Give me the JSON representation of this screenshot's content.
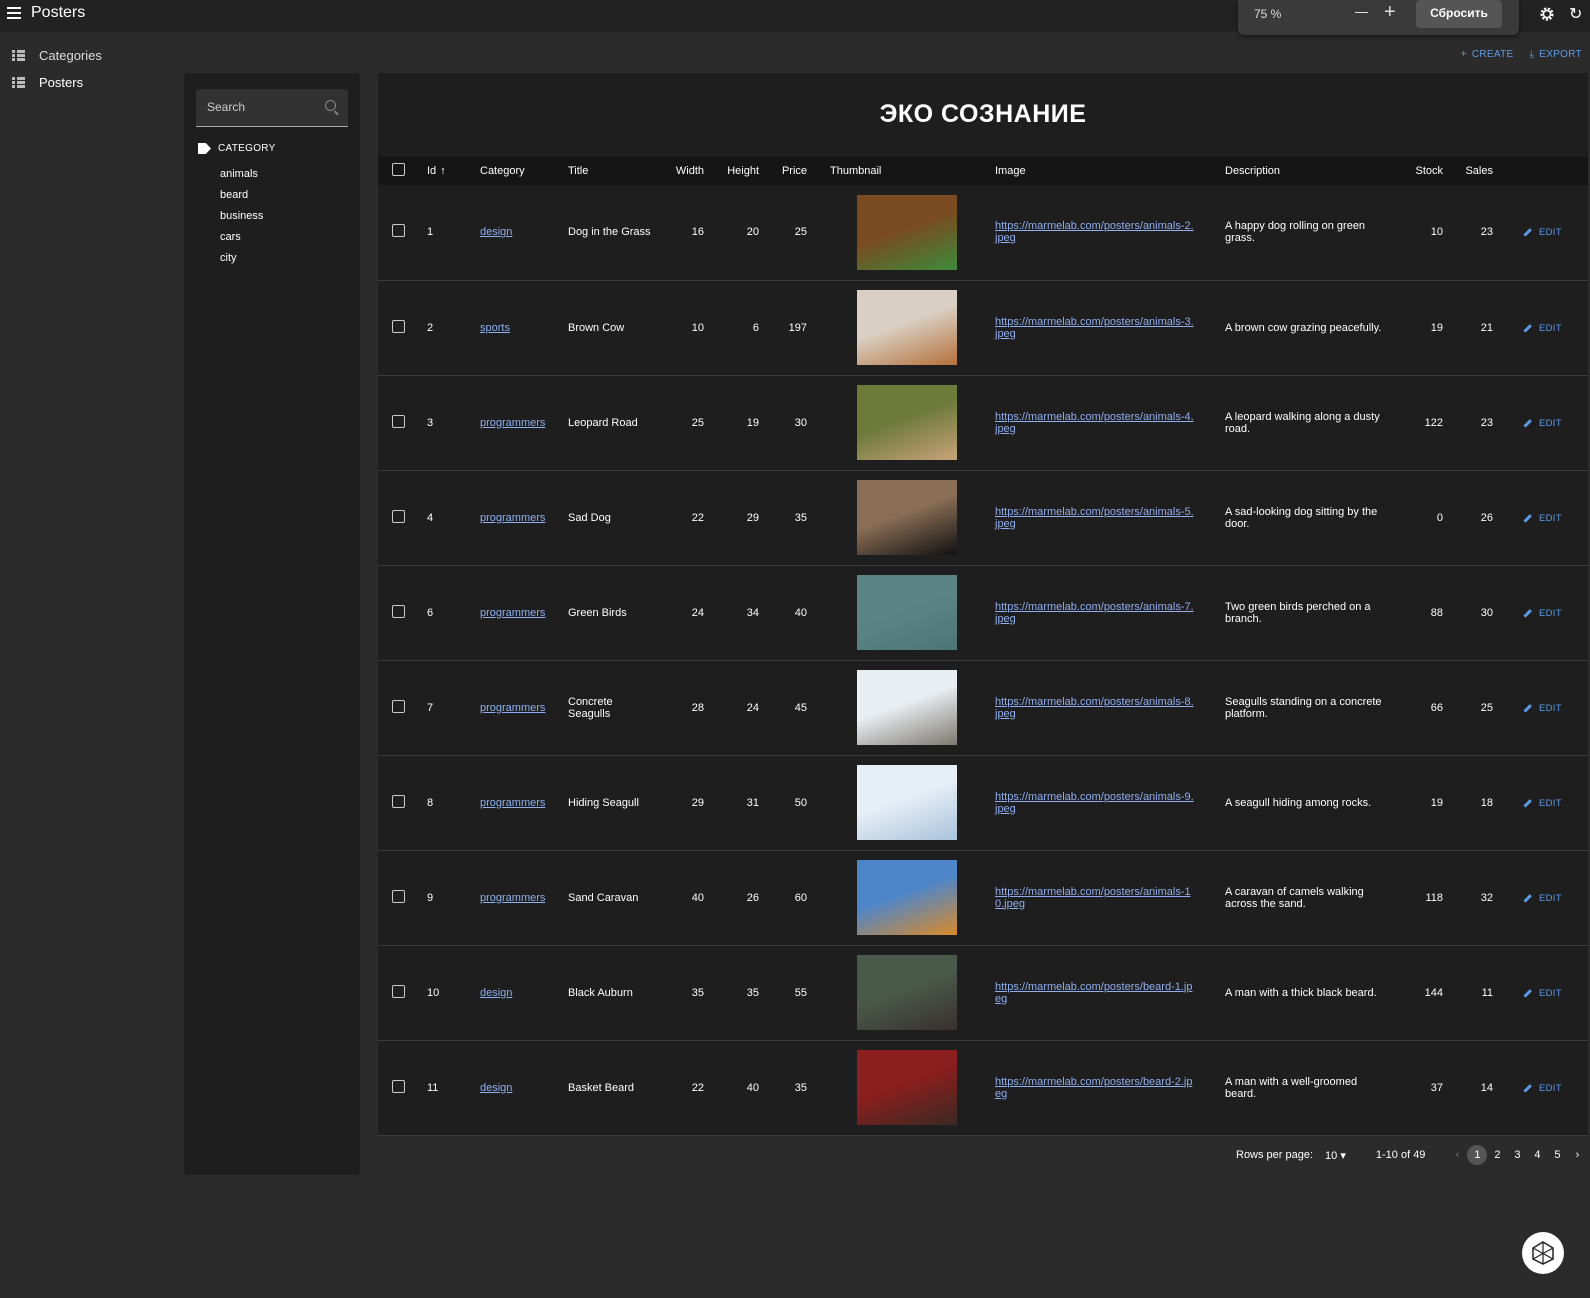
{
  "app": {
    "title": "Posters"
  },
  "zoom": {
    "value": "75 %",
    "reset_label": "Сбросить"
  },
  "sidebar": {
    "items": [
      {
        "label": "Categories"
      },
      {
        "label": "Posters"
      }
    ]
  },
  "actions": {
    "create_label": "CREATE",
    "export_label": "EXPORT"
  },
  "filter": {
    "search_placeholder": "Search",
    "category_heading": "CATEGORY",
    "categories": [
      "animals",
      "beard",
      "business",
      "cars",
      "city"
    ]
  },
  "page": {
    "heading": "ЭКО СОЗНАНИЕ"
  },
  "table": {
    "headers": {
      "id": "Id",
      "category": "Category",
      "title": "Title",
      "width": "Width",
      "height": "Height",
      "price": "Price",
      "thumbnail": "Thumbnail",
      "image": "Image",
      "description": "Description",
      "stock": "Stock",
      "sales": "Sales"
    },
    "edit_label": "EDIT",
    "rows": [
      {
        "id": "1",
        "category": "design",
        "title": "Dog in the Grass",
        "width": "16",
        "height": "20",
        "price": "25",
        "image": "https://marmelab.com/posters/animals-2.jpeg",
        "description": "A happy dog rolling on green grass.",
        "stock": "10",
        "sales": "23",
        "thumb_colors": [
          "#7a4a22",
          "#3e8a3a"
        ]
      },
      {
        "id": "2",
        "category": "sports",
        "title": "Brown Cow",
        "width": "10",
        "height": "6",
        "price": "197",
        "image": "https://marmelab.com/posters/animals-3.jpeg",
        "description": "A brown cow grazing peacefully.",
        "stock": "19",
        "sales": "21",
        "thumb_colors": [
          "#d9cfc2",
          "#b4703a"
        ]
      },
      {
        "id": "3",
        "category": "programmers",
        "title": "Leopard Road",
        "width": "25",
        "height": "19",
        "price": "30",
        "image": "https://marmelab.com/posters/animals-4.jpeg",
        "description": "A leopard walking along a dusty road.",
        "stock": "122",
        "sales": "23",
        "thumb_colors": [
          "#6d7a3a",
          "#c8a27a"
        ]
      },
      {
        "id": "4",
        "category": "programmers",
        "title": "Sad Dog",
        "width": "22",
        "height": "29",
        "price": "35",
        "image": "https://marmelab.com/posters/animals-5.jpeg",
        "description": "A sad-looking dog sitting by the door.",
        "stock": "0",
        "sales": "26",
        "thumb_colors": [
          "#8a6e55",
          "#111111"
        ]
      },
      {
        "id": "6",
        "category": "programmers",
        "title": "Green Birds",
        "width": "24",
        "height": "34",
        "price": "40",
        "image": "https://marmelab.com/posters/animals-7.jpeg",
        "description": "Two green birds perched on a branch.",
        "stock": "88",
        "sales": "30",
        "thumb_colors": [
          "#5b8585",
          "#4d7575"
        ]
      },
      {
        "id": "7",
        "category": "programmers",
        "title": "Concrete Seagulls",
        "width": "28",
        "height": "24",
        "price": "45",
        "image": "https://marmelab.com/posters/animals-8.jpeg",
        "description": "Seagulls standing on a concrete platform.",
        "stock": "66",
        "sales": "25",
        "thumb_colors": [
          "#e9eef2",
          "#7d7870"
        ]
      },
      {
        "id": "8",
        "category": "programmers",
        "title": "Hiding Seagull",
        "width": "29",
        "height": "31",
        "price": "50",
        "image": "https://marmelab.com/posters/animals-9.jpeg",
        "description": "A seagull hiding among rocks.",
        "stock": "19",
        "sales": "18",
        "thumb_colors": [
          "#e6eef6",
          "#a9c3dc"
        ]
      },
      {
        "id": "9",
        "category": "programmers",
        "title": "Sand Caravan",
        "width": "40",
        "height": "26",
        "price": "60",
        "image": "https://marmelab.com/posters/animals-10.jpeg",
        "description": "A caravan of camels walking across the sand.",
        "stock": "118",
        "sales": "32",
        "thumb_colors": [
          "#4f86c9",
          "#d98a2a"
        ]
      },
      {
        "id": "10",
        "category": "design",
        "title": "Black Auburn",
        "width": "35",
        "height": "35",
        "price": "55",
        "image": "https://marmelab.com/posters/beard-1.jpeg",
        "description": "A man with a thick black beard.",
        "stock": "144",
        "sales": "11",
        "thumb_colors": [
          "#4a5a4a",
          "#3a3030"
        ]
      },
      {
        "id": "11",
        "category": "design",
        "title": "Basket Beard",
        "width": "22",
        "height": "40",
        "price": "35",
        "image": "https://marmelab.com/posters/beard-2.jpeg",
        "description": "A man with a well-groomed beard.",
        "stock": "37",
        "sales": "14",
        "thumb_colors": [
          "#8b1e1e",
          "#3a2a22"
        ]
      }
    ]
  },
  "pagination": {
    "rows_per_page_label": "Rows per page:",
    "rows_per_page_value": "10",
    "range_label": "1-10 of 49",
    "pages": [
      "1",
      "2",
      "3",
      "4",
      "5"
    ],
    "current_page": "1"
  },
  "colors": {
    "accent": "#5c9be6",
    "link": "#90aef0",
    "background": "#2b2b2b",
    "surface": "#1e1e1e"
  }
}
